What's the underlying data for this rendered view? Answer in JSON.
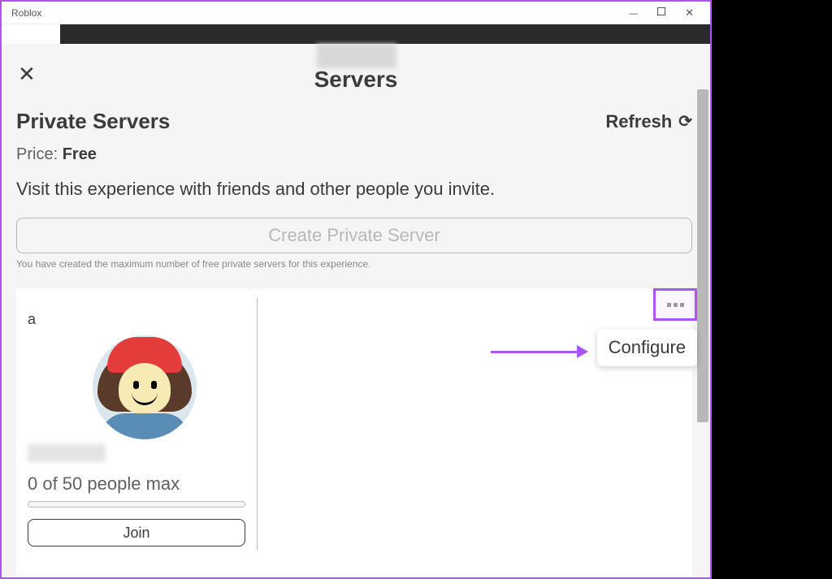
{
  "window": {
    "title": "Roblox"
  },
  "modal": {
    "heading": "Servers",
    "section_title": "Private Servers",
    "refresh_label": "Refresh",
    "price_label": "Price:",
    "price_value": "Free",
    "visit_text": "Visit this experience with friends and other people you invite.",
    "create_button": "Create Private Server",
    "max_note": "You have created the maximum number of free private servers for this experience."
  },
  "server": {
    "name": "a",
    "people_text": "0 of 50 people max",
    "join_label": "Join"
  },
  "menu": {
    "configure": "Configure"
  }
}
